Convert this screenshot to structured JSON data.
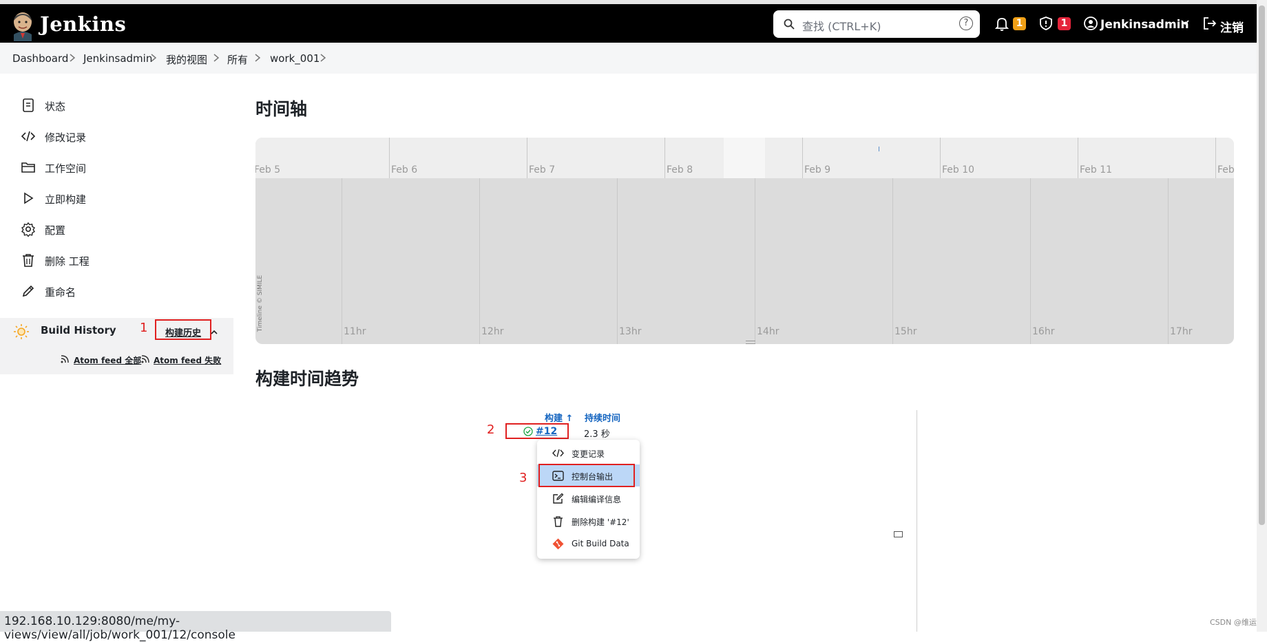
{
  "header": {
    "brand": "Jenkins",
    "search_placeholder": "查找 (CTRL+K)",
    "help": "?",
    "notifications_count": "1",
    "security_count": "1",
    "user": "Jenkinsadmin",
    "logout": "注销",
    "colors": {
      "notify_badge": "#f0a016",
      "security_badge": "#e5243b"
    }
  },
  "breadcrumb": [
    "Dashboard",
    "Jenkinsadmin",
    "我的视图",
    "所有",
    "work_001"
  ],
  "sidebar": {
    "items": [
      {
        "label": "状态",
        "icon": "notepad-icon"
      },
      {
        "label": "修改记录",
        "icon": "code-icon"
      },
      {
        "label": "工作空间",
        "icon": "folder-icon"
      },
      {
        "label": "立即构建",
        "icon": "play-icon"
      },
      {
        "label": "配置",
        "icon": "gear-icon"
      },
      {
        "label": "删除 工程",
        "icon": "trash-icon"
      },
      {
        "label": "重命名",
        "icon": "pencil-icon"
      }
    ],
    "build_history": {
      "title": "Build History",
      "link": "构建历史",
      "feed_all": "Atom feed 全部",
      "feed_failed": "Atom feed 失败"
    }
  },
  "main": {
    "timeline_title": "时间轴",
    "timeline": {
      "days": [
        "Feb 5",
        "Feb 6",
        "Feb 7",
        "Feb 8",
        "Feb 9",
        "Feb 10",
        "Feb 11",
        "Feb"
      ],
      "hours": [
        "11hr",
        "12hr",
        "13hr",
        "14hr",
        "15hr",
        "16hr",
        "17hr"
      ],
      "credit": "Timeline © SIMILE"
    },
    "trend_title": "构建时间趋势",
    "trend": {
      "col_build": "构建 ↑",
      "col_duration": "持续时间",
      "build_number": "#12",
      "duration": "2.3 秒"
    },
    "context_menu": [
      {
        "label": "变更记录",
        "icon": "code-icon"
      },
      {
        "label": "控制台输出",
        "icon": "terminal-icon"
      },
      {
        "label": "编辑编译信息",
        "icon": "edit-icon"
      },
      {
        "label": "删除构建 '#12'",
        "icon": "trash-icon"
      },
      {
        "label": "Git Build Data",
        "icon": "git-icon"
      }
    ]
  },
  "annotations": {
    "one": "1",
    "two": "2",
    "three": "3"
  },
  "status_url": "192.168.10.129:8080/me/my-views/view/all/job/work_001/12/console",
  "watermark": "CSDN @维运"
}
